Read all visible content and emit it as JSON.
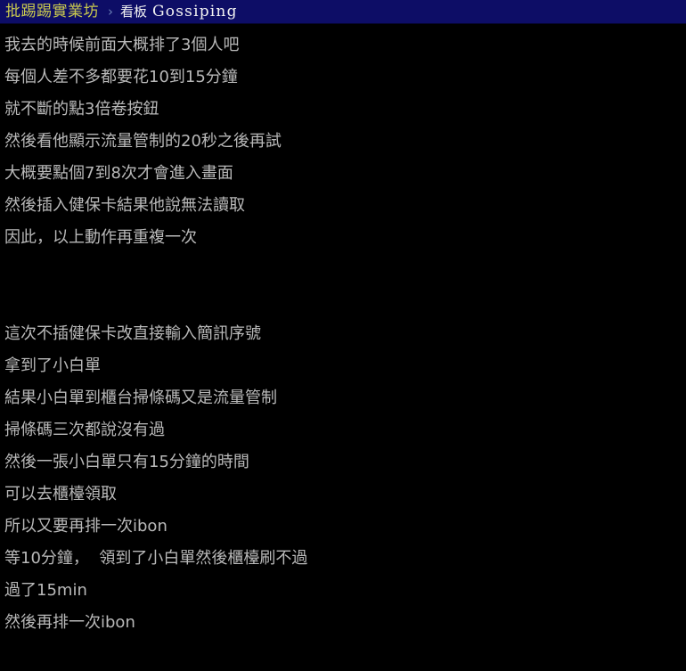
{
  "window": {
    "background_color": "#000000",
    "text_color": "#b9b9b9"
  },
  "breadcrumb": {
    "board_title": "批踢踢實業坊",
    "board_title_color": "#c8c84f",
    "separator_icon": "chevron-right-icon",
    "separator": "›",
    "board_label": "看板",
    "board_name": "Gossiping",
    "bar_color": "#0d0d66"
  },
  "post": {
    "lines": [
      "我去的時候前面大概排了3個人吧",
      "每個人差不多都要花10到15分鐘",
      "就不斷的點3倍卷按鈕",
      "然後看他顯示流量管制的20秒之後再試",
      "大概要點個7到8次才會進入畫面",
      "然後插入健保卡結果他說無法讀取",
      "因此，以上動作再重複一次",
      "",
      "",
      "這次不插健保卡改直接輸入簡訊序號",
      "拿到了小白單",
      "結果小白單到櫃台掃條碼又是流量管制",
      "掃條碼三次都說沒有過",
      "然後一張小白單只有15分鐘的時間",
      "可以去櫃檯領取",
      "所以又要再排一次ibon",
      "等10分鐘，  領到了小白單然後櫃檯刷不過",
      "過了15min",
      "然後再排一次ibon"
    ]
  }
}
